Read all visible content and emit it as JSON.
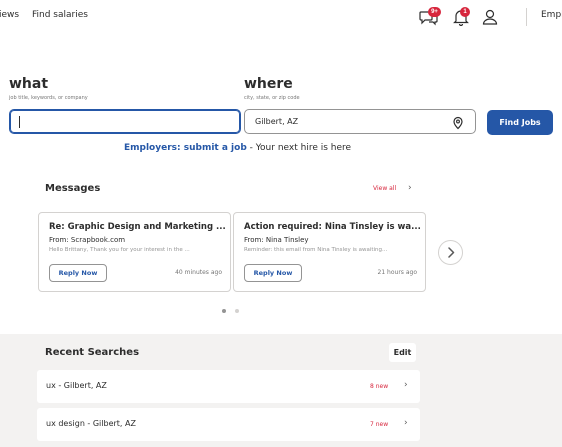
{
  "nav": {
    "reviews_link": "iews",
    "salaries_link": "Find salaries",
    "messages_badge": "9+",
    "notifications_badge": "1",
    "employers_link": "Empl"
  },
  "search": {
    "what_label": "what",
    "what_hint": "job title, keywords, or company",
    "what_value": "",
    "where_label": "where",
    "where_hint": "city, state, or zip code",
    "where_value": "Gilbert, AZ",
    "find_button": "Find Jobs",
    "employers_link": "Employers: submit a job",
    "employers_sep": " - ",
    "employers_tail": "Your next hire is here"
  },
  "messages": {
    "title": "Messages",
    "view_all": "View all",
    "cards": [
      {
        "title": "Re: Graphic Design and Marketing ...",
        "from": "From: Scrapbook.com",
        "snippet": "Hello Brittany, Thank you for your interest in the ...",
        "reply": "Reply Now",
        "time": "40 minutes ago"
      },
      {
        "title": "Action required: Nina Tinsley is wa...",
        "from": "From: Nina Tinsley",
        "snippet": "Reminder: this email from Nina Tinsley is awaiting...",
        "reply": "Reply Now",
        "time": "21 hours ago"
      }
    ]
  },
  "recent": {
    "title": "Recent Searches",
    "edit": "Edit",
    "rows": [
      {
        "query": "ux - Gilbert, AZ",
        "new_count": "8 new"
      },
      {
        "query": "ux design - Gilbert, AZ",
        "new_count": "7 new"
      }
    ]
  },
  "colors": {
    "accent_blue": "#2557a7",
    "alert_red": "#d7263d",
    "recent_bg": "#f3f2f1"
  },
  "icons": [
    "messages-icon",
    "notifications-icon",
    "profile-icon",
    "location-pin-icon",
    "chevron-right-icon"
  ]
}
